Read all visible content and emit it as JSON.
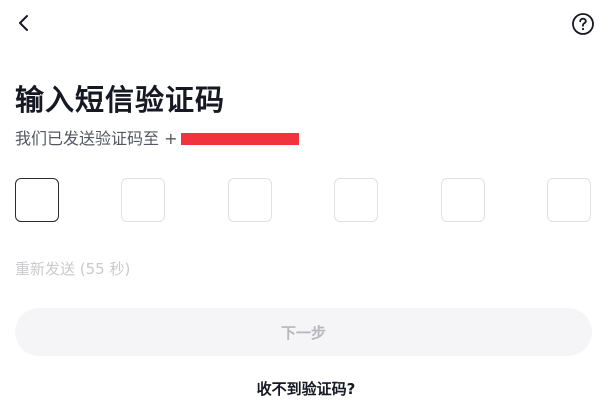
{
  "header": {
    "back_icon": "chevron-left-icon",
    "help_icon": "question-circle-icon"
  },
  "title": "输入短信验证码",
  "subtitle": {
    "prefix": "我们已发送验证码至 +",
    "redaction_color": "#f0333c"
  },
  "code_inputs": {
    "count": 6,
    "values": [
      "",
      "",
      "",
      "",
      "",
      ""
    ],
    "active_index": 0
  },
  "resend": {
    "label": "重新发送 (55 秒)"
  },
  "next_button": {
    "label": "下一步"
  },
  "help_link": {
    "label": "收不到验证码?"
  },
  "colors": {
    "text": "#161823",
    "muted": "#c9cacd",
    "button_bg": "#f5f5f7",
    "button_text": "#b6b7bb",
    "redaction": "#f0333c"
  }
}
